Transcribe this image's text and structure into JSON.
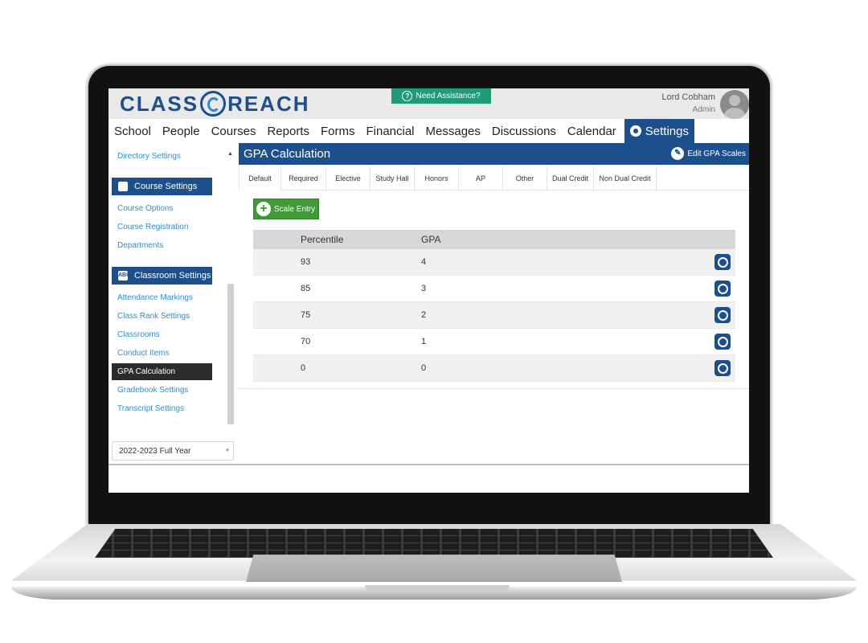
{
  "brand": {
    "left": "CLASS",
    "right": "REACH"
  },
  "assist": {
    "label": "Need Assistance?"
  },
  "user": {
    "name": "Lord Cobham",
    "role": "Admin"
  },
  "nav": {
    "items": [
      "School",
      "People",
      "Courses",
      "Reports",
      "Forms",
      "Financial",
      "Messages",
      "Discussions",
      "Calendar"
    ],
    "active": "Settings"
  },
  "sidebar": {
    "directory": "Directory Settings",
    "course_header": "Course Settings",
    "course_links": [
      "Course Options",
      "Course Registration",
      "Departments"
    ],
    "classroom_header": "Classroom Settings",
    "classroom_icon": "ABC",
    "classroom_links": [
      "Attendance Markings",
      "Class Rank Settings",
      "Classrooms",
      "Conduct Items"
    ],
    "active_link": "GPA Calculation",
    "more_links": [
      "Gradebook Settings",
      "Transcript Settings"
    ],
    "year": "2022-2023 Full Year"
  },
  "panel": {
    "title": "GPA Calculation",
    "edit_label": "Edit GPA Scales",
    "tabs": [
      "Default",
      "Required",
      "Elective",
      "Study Hall",
      "Honors",
      "AP",
      "Other",
      "Dual Credit",
      "Non Dual Credit"
    ],
    "active_tab": "Default",
    "add_button": "Scale Entry"
  },
  "grid": {
    "headers": [
      "Percentile",
      "GPA"
    ],
    "rows": [
      {
        "percentile": "93",
        "gpa": "4"
      },
      {
        "percentile": "85",
        "gpa": "3"
      },
      {
        "percentile": "75",
        "gpa": "2"
      },
      {
        "percentile": "70",
        "gpa": "1"
      },
      {
        "percentile": "0",
        "gpa": "0"
      }
    ]
  },
  "colors": {
    "brand_blue": "#1c4f8c",
    "link_blue": "#2f8dcc",
    "assist_green": "#1e9b78",
    "add_green": "#3d9a35"
  }
}
